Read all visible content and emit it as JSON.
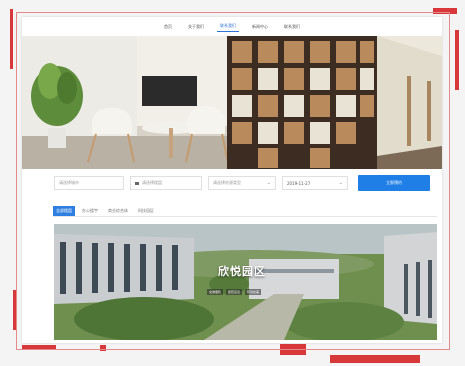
{
  "nav": {
    "items": [
      "首页",
      "关于我们",
      "联系我们",
      "新闻中心",
      "联系我们"
    ],
    "active_index": 2
  },
  "search": {
    "field1_placeholder": "请选择城市",
    "field2_placeholder": "请选择楼盘",
    "field3_placeholder": "请选择房源类型",
    "date_value": "2019-11-27",
    "button_label": "立即预约"
  },
  "tabs": {
    "items": [
      "全部楼盘",
      "办公楼宇",
      "商业综合体",
      "科技园区"
    ],
    "active_index": 0
  },
  "banner": {
    "title": "欣悦园区",
    "tags": [
      "交通便利",
      "配套完善",
      "环境优美"
    ]
  },
  "colors": {
    "accent": "#1f7fe6",
    "frame": "#d9383a"
  }
}
